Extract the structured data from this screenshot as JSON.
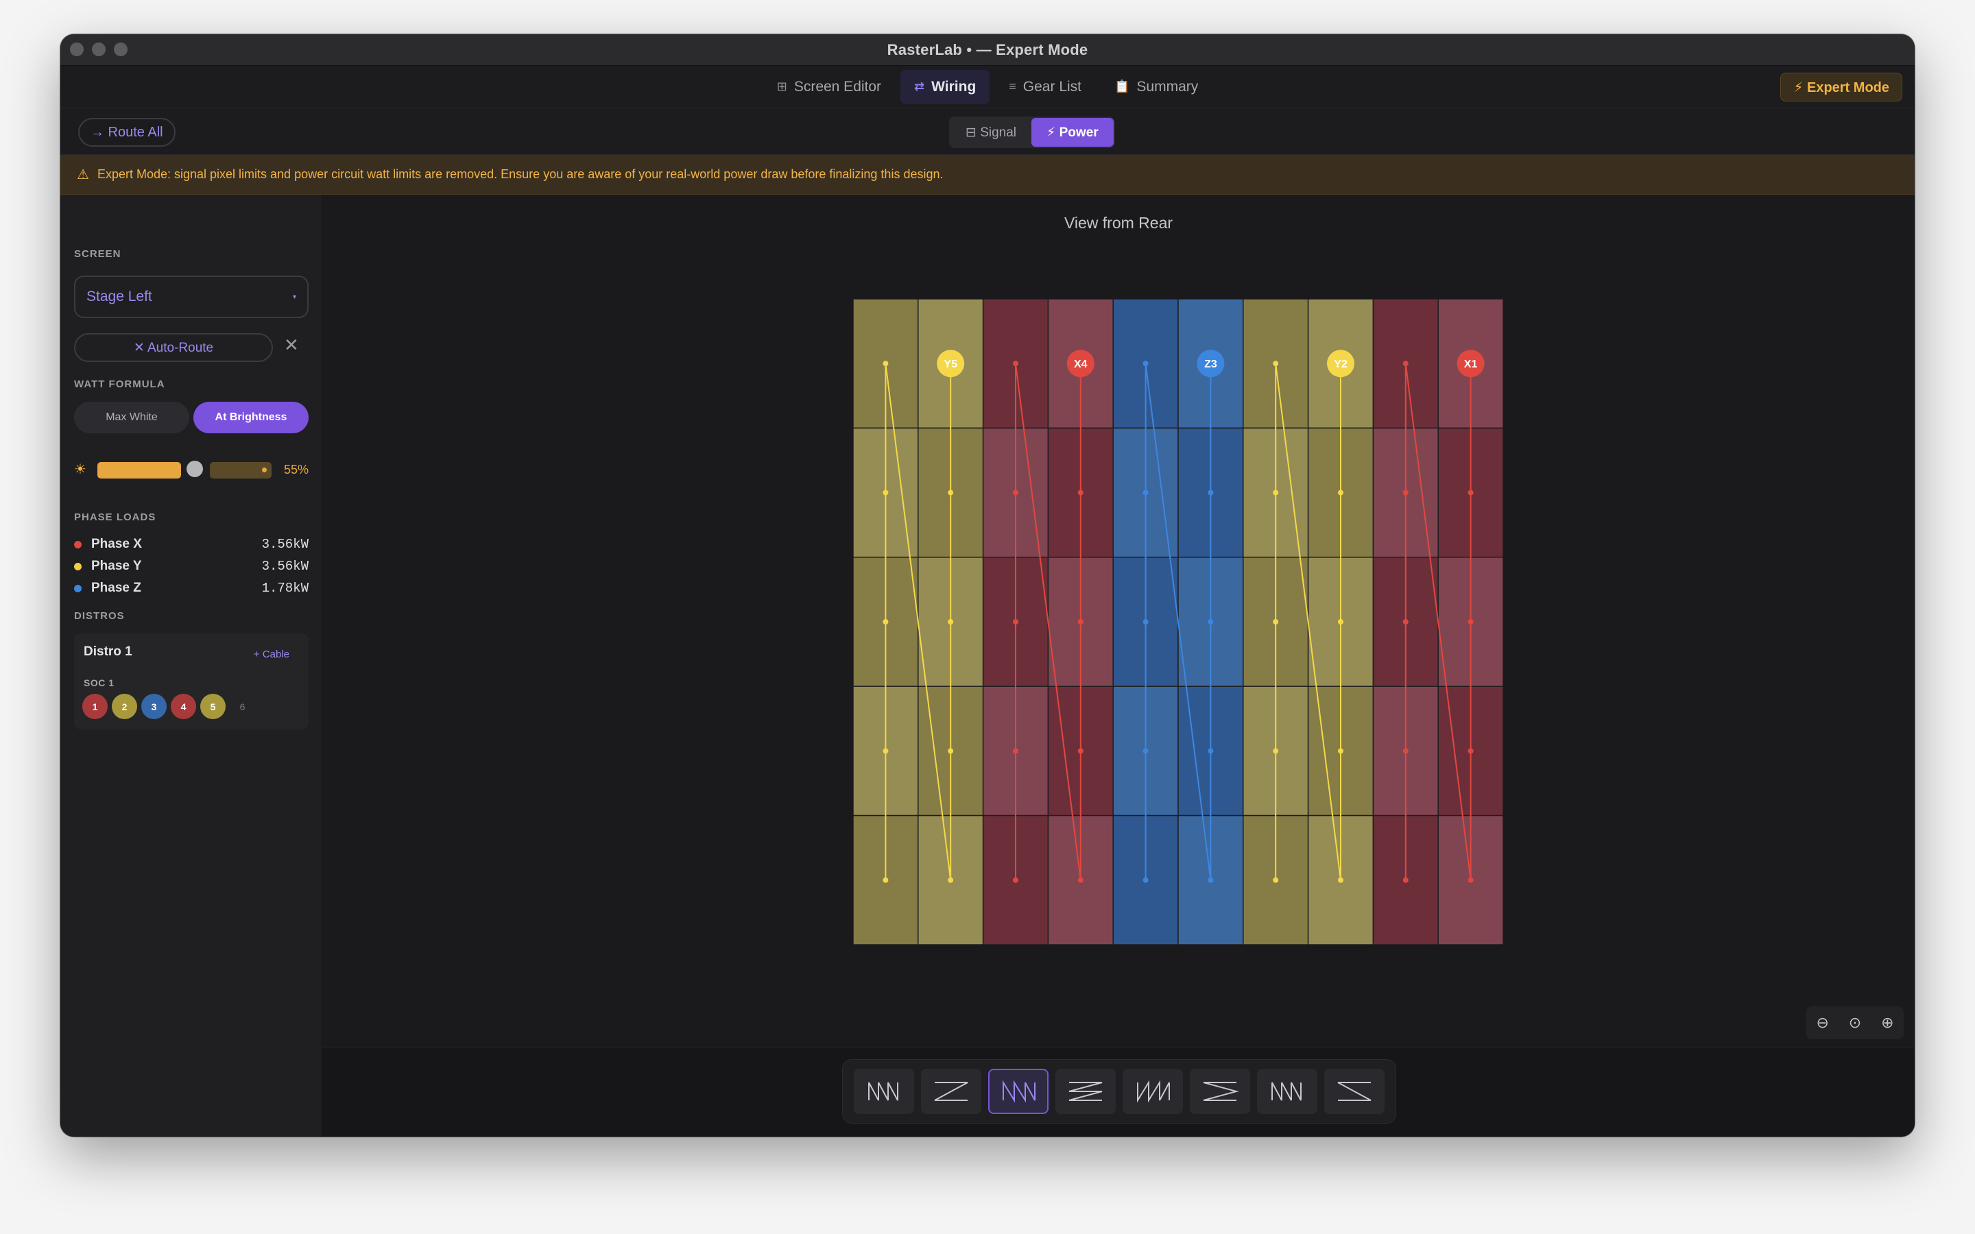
{
  "window": {
    "title": "RasterLab • — Expert Mode"
  },
  "tabs": [
    {
      "label": "Screen Editor",
      "icon": "grid-icon",
      "glyph": "⊞",
      "active": false
    },
    {
      "label": "Wiring",
      "icon": "swap-icon",
      "glyph": "⇄",
      "active": true
    },
    {
      "label": "Gear List",
      "icon": "list-icon",
      "glyph": "≡",
      "active": false
    },
    {
      "label": "Summary",
      "icon": "clipboard-icon",
      "glyph": "📋",
      "active": false
    }
  ],
  "expert_mode": {
    "label": "⚡ Expert Mode"
  },
  "toolbar": {
    "route_all": "→ Route All",
    "signal": "⊟ Signal",
    "power": "⚡ Power"
  },
  "banner": {
    "icon": "warning-icon",
    "text": "Expert Mode: signal pixel limits and power circuit watt limits are removed. Ensure you are aware of your real-world power draw before finalizing this design."
  },
  "sidebar": {
    "screen_label": "SCREEN",
    "screen_value": "Stage Left",
    "auto_route": "✕  Auto-Route",
    "close": "✕",
    "watt_label": "WATT FORMULA",
    "watt_options": [
      "Max White",
      "At Brightness"
    ],
    "watt_selected": "At Brightness",
    "brightness": {
      "value": 0.55,
      "label": "55%"
    },
    "phase_label": "PHASE LOADS",
    "phases": [
      {
        "name": "Phase X",
        "value": "3.56kW",
        "color": "#e0483f"
      },
      {
        "name": "Phase Y",
        "value": "3.56kW",
        "color": "#f2d046"
      },
      {
        "name": "Phase Z",
        "value": "1.78kW",
        "color": "#3d86e0"
      }
    ],
    "distros_label": "DISTROS",
    "distro": {
      "title": "Distro 1",
      "cable": "+ Cable",
      "soc": "SOC 1",
      "circuits": [
        {
          "n": "1",
          "color": "#a83a3c"
        },
        {
          "n": "2",
          "color": "#a89a3c"
        },
        {
          "n": "3",
          "color": "#3468aa"
        },
        {
          "n": "4",
          "color": "#a83a3c"
        },
        {
          "n": "5",
          "color": "#a89a3c"
        }
      ],
      "empty": "6"
    }
  },
  "canvas": {
    "title": "View from Rear",
    "grid": {
      "cols": 10,
      "rows": 5,
      "column_phase": [
        "Y",
        "Y",
        "X",
        "X",
        "Z",
        "Z",
        "Y",
        "Y",
        "X",
        "X"
      ],
      "circuit_labels": [
        "Y5",
        "X4",
        "Z3",
        "Y2",
        "X1"
      ]
    },
    "zoom": {
      "out": "⊖",
      "reset": "⊙",
      "in": "⊕"
    }
  },
  "patterns": {
    "count": 8,
    "active": 2
  },
  "colors": {
    "Y": {
      "a": "#857c46",
      "b": "#968d55",
      "line": "#f4d84a"
    },
    "X": {
      "a": "#6c2f3a",
      "b": "#814552",
      "line": "#e0483f"
    },
    "Z": {
      "a": "#305890",
      "b": "#3c68a0",
      "line": "#3d86e0"
    },
    "accent": "#7a52dd",
    "warning": "#f2b347"
  }
}
